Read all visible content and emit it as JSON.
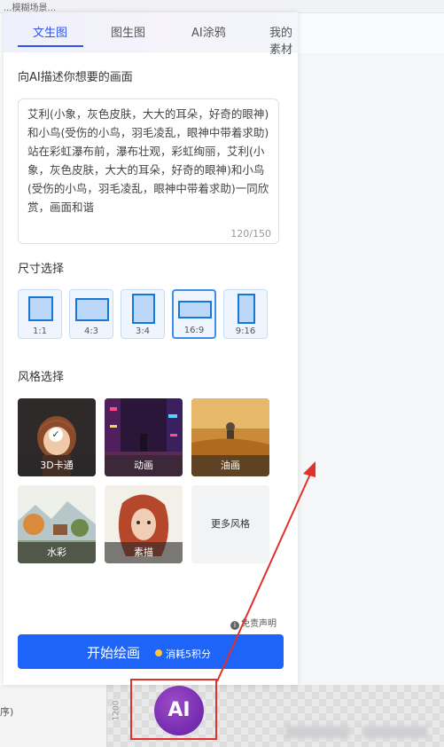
{
  "tabs": [
    {
      "label": "文生图",
      "active": true
    },
    {
      "label": "图生图",
      "active": false
    },
    {
      "label": "AI涂鸦",
      "active": false
    },
    {
      "label": "我的素材",
      "active": false
    }
  ],
  "prompt": {
    "label": "向AI描述你想要的画面",
    "value": "艾利(小象，灰色皮肤，大大的耳朵，好奇的眼神)和小鸟(受伤的小鸟，羽毛凌乱，眼神中带着求助)站在彩虹瀑布前，瀑布壮观，彩虹绚丽，艾利(小象，灰色皮肤，大大的耳朵，好奇的眼神)和小鸟(受伤的小鸟，羽毛凌乱，眼神中带着求助)一同欣赏，画面和谐",
    "counter": "120/150"
  },
  "size": {
    "label": "尺寸选择",
    "options": [
      {
        "label": "1:1",
        "selected": false
      },
      {
        "label": "4:3",
        "selected": false
      },
      {
        "label": "3:4",
        "selected": false
      },
      {
        "label": "16:9",
        "selected": true
      },
      {
        "label": "9:16",
        "selected": false
      }
    ]
  },
  "style": {
    "label": "风格选择",
    "options": [
      {
        "label": "3D卡通",
        "selected": true
      },
      {
        "label": "动画",
        "selected": false
      },
      {
        "label": "油画",
        "selected": false
      },
      {
        "label": "水彩",
        "selected": false
      },
      {
        "label": "素描",
        "selected": false
      },
      {
        "label": "更多风格",
        "selected": false
      }
    ]
  },
  "disclaimer": "免责声明",
  "start": {
    "label": "开始绘画",
    "cost": "消耗5积分"
  },
  "background": {
    "top_text": "...模糊场景...",
    "ruler_text": "1200",
    "edge_text": "序)"
  },
  "logo_text": "AI",
  "colors": {
    "accent": "#2f54eb",
    "button": "#1e64f8",
    "annotation": "#e0312b"
  }
}
